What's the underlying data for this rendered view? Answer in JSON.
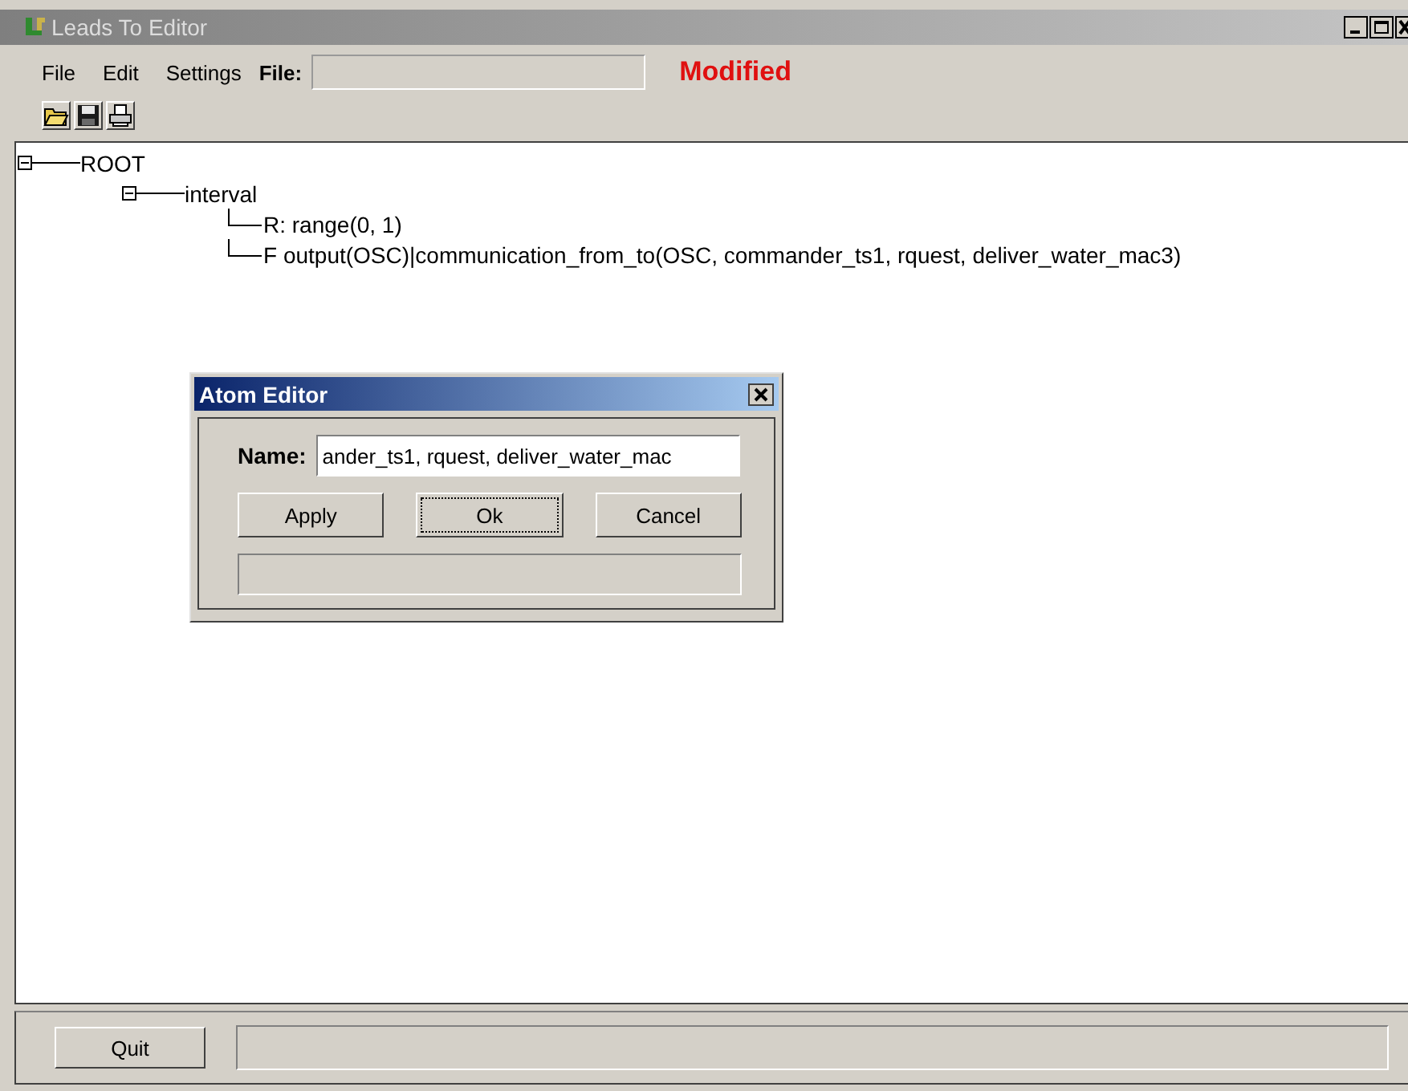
{
  "window": {
    "title": "Leads To Editor"
  },
  "menu": [
    {
      "label": "File"
    },
    {
      "label": "Edit"
    },
    {
      "label": "Settings"
    }
  ],
  "file_field": {
    "label": "File:"
  },
  "status": "Modified",
  "tree": {
    "label": "ROOT",
    "expanded": true,
    "children": [
      {
        "label": "interval",
        "expanded": true,
        "children": [
          {
            "label": "R: range(0, 1)"
          },
          {
            "label": "F output(OSC)|communication_from_to(OSC, commander_ts1, rquest, deliver_water_mac3)"
          }
        ]
      }
    ]
  },
  "dialog": {
    "title": "Atom Editor",
    "name_label": "Name:",
    "name_value": "ander_ts1, rquest, deliver_water_mac",
    "buttons": [
      {
        "label": "Apply",
        "focused": false
      },
      {
        "label": "Ok",
        "focused": true
      },
      {
        "label": "Cancel",
        "focused": false
      }
    ]
  },
  "quit": "Quit"
}
